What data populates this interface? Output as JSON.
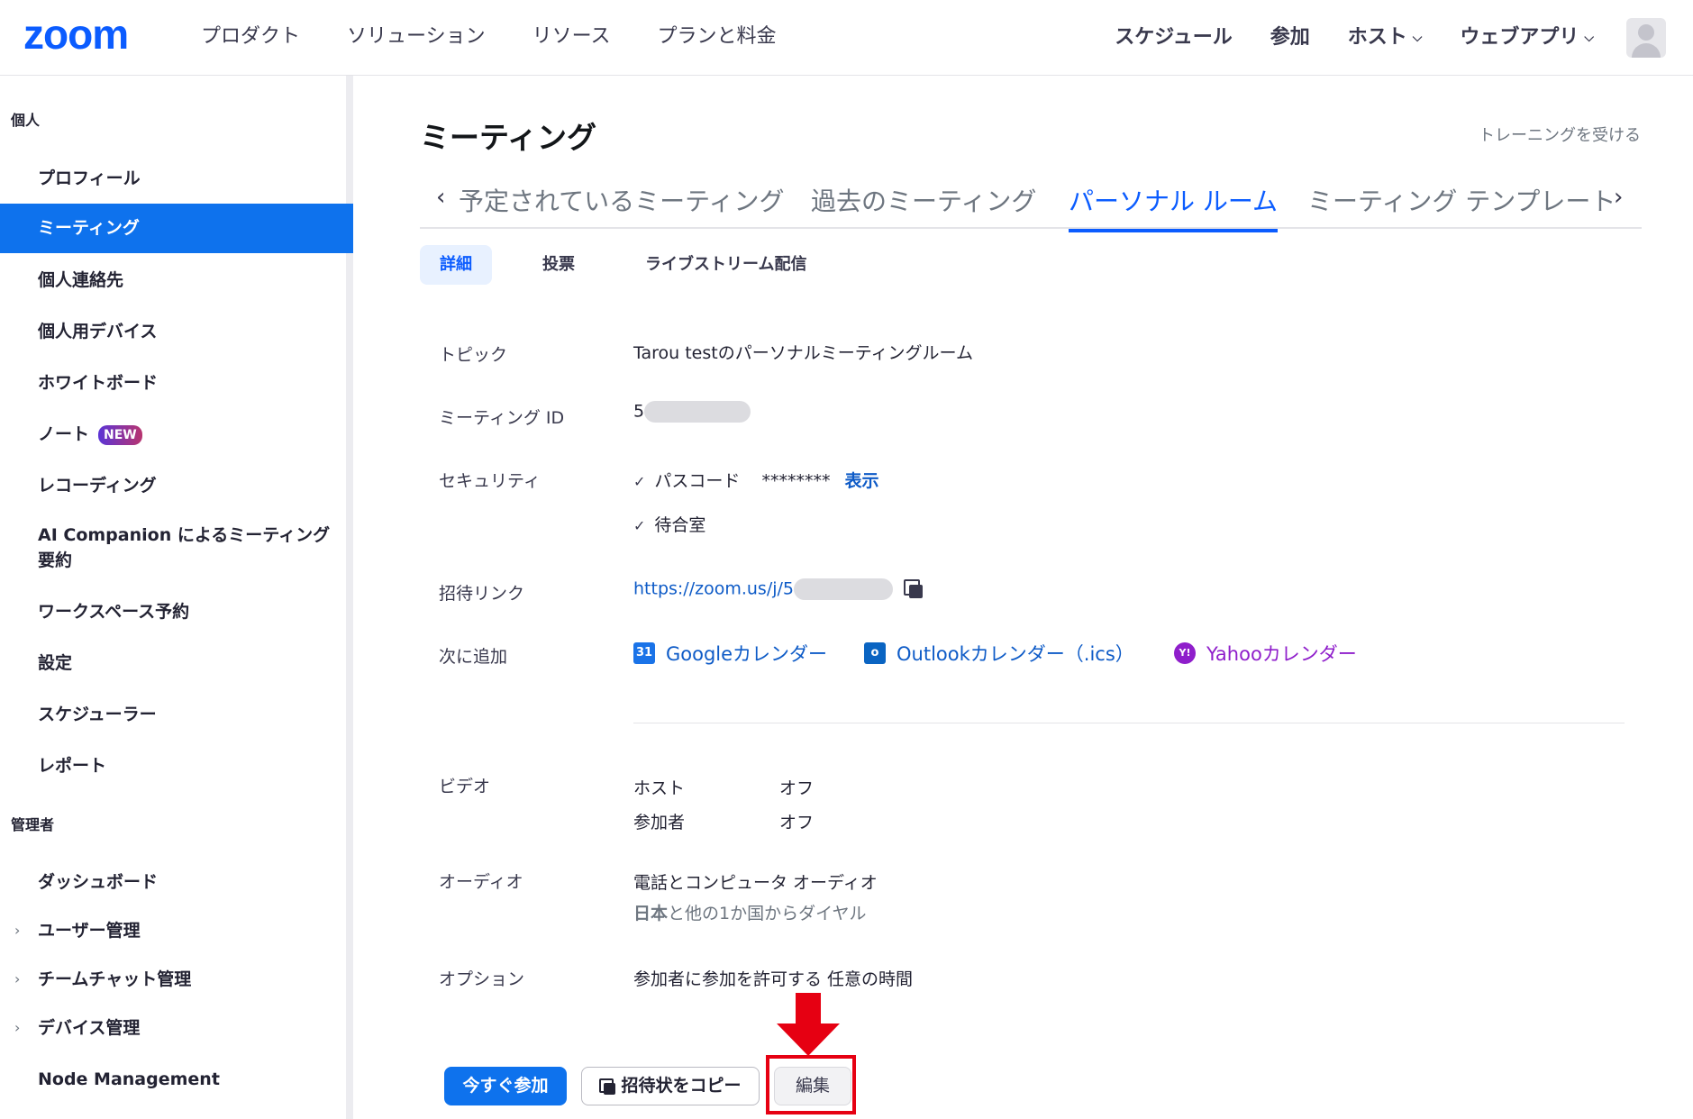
{
  "brand": {
    "logo_text": "zoom",
    "accent": "#0b5cff"
  },
  "topnav": {
    "left": [
      "プロダクト",
      "ソリューション",
      "リソース",
      "プランと料金"
    ],
    "right": {
      "schedule": "スケジュール",
      "join": "参加",
      "host": "ホスト",
      "webapp": "ウェブアプリ"
    }
  },
  "sidebar": {
    "section_personal": "個人",
    "items_personal": [
      "プロフィール",
      "ミーティング",
      "個人連絡先",
      "個人用デバイス",
      "ホワイトボード",
      "ノート",
      "レコーディング",
      "AI Companion によるミーティング要約",
      "ワークスペース予約",
      "設定",
      "スケジューラー",
      "レポート"
    ],
    "badge_new": "NEW",
    "section_admin": "管理者",
    "items_admin": [
      "ダッシュボード",
      "ユーザー管理",
      "チームチャット管理",
      "デバイス管理",
      "Node Management"
    ]
  },
  "main": {
    "title": "ミーティング",
    "training_link": "トレーニングを受ける",
    "tabs": [
      "予定されているミーティング",
      "過去のミーティング",
      "パーソナル ルーム",
      "ミーティング テンプレート"
    ],
    "subtabs": [
      "詳細",
      "投票",
      "ライブストリーム配信"
    ],
    "rows": {
      "topic_label": "トピック",
      "topic_value": "Tarou testのパーソナルミーティングルーム",
      "meeting_id_label": "ミーティング ID",
      "meeting_id_prefix": "5",
      "security_label": "セキュリティ",
      "passcode_label": "パスコード",
      "passcode_mask": "********",
      "show_link": "表示",
      "waiting_room": "待合室",
      "invite_label": "招待リンク",
      "invite_prefix": "https://zoom.us/j/5",
      "add_to_label": "次に追加",
      "google_cal": "Googleカレンダー",
      "outlook_cal": "Outlookカレンダー（.ics）",
      "yahoo_cal": "Yahooカレンダー",
      "video_label": "ビデオ",
      "host_label": "ホスト",
      "host_value": "オフ",
      "participant_label": "参加者",
      "participant_value": "オフ",
      "audio_label": "オーディオ",
      "audio_value": "電話とコンピュータ オーディオ",
      "dial_country": "日本",
      "dial_suffix": "と他の1か国からダイヤル",
      "options_label": "オプション",
      "options_value": "参加者に参加を許可する 任意の時間"
    },
    "buttons": {
      "join_now": "今すぐ参加",
      "copy_invite": "招待状をコピー",
      "edit": "編集"
    }
  },
  "colors": {
    "active_blue": "#0e72ed",
    "link": "#0e5bc7",
    "highlight_red": "#e60012",
    "yahoo_purple": "#8f1ecb"
  },
  "icons": [
    "chevron-left-icon",
    "chevron-right-icon",
    "copy-icon",
    "check-icon",
    "google-calendar-icon",
    "outlook-icon",
    "yahoo-icon",
    "avatar-icon"
  ]
}
